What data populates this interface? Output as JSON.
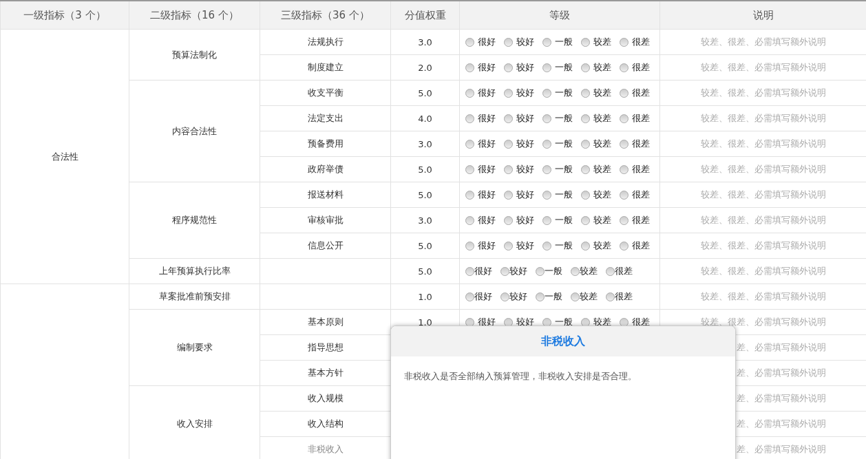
{
  "header": [
    "一级指标（3 个）",
    "二级指标（16 个）",
    "三级指标（36 个）",
    "分值权重",
    "等级",
    "说明"
  ],
  "groups": [
    {
      "label": "合法性",
      "sections": [
        {
          "label": "预算法制化",
          "items": [
            {
              "kind": "full",
              "label": "法规执行",
              "weight": "3.0",
              "grades": [
                {
                  "label": "很好",
                  "selected": false
                },
                {
                  "label": "较好",
                  "selected": false
                },
                {
                  "label": "一般",
                  "selected": false
                },
                {
                  "label": "较差",
                  "selected": false
                },
                {
                  "label": "很差",
                  "selected": false
                }
              ],
              "note": "较差、很差、必需填写额外说明"
            },
            {
              "kind": "full",
              "label": "制度建立",
              "weight": "2.0",
              "grades": [
                {
                  "label": "很好",
                  "selected": false
                },
                {
                  "label": "较好",
                  "selected": false
                },
                {
                  "label": "一般",
                  "selected": false
                },
                {
                  "label": "较差",
                  "selected": false
                },
                {
                  "label": "很差",
                  "selected": false
                }
              ],
              "note": "较差、很差、必需填写额外说明"
            }
          ]
        },
        {
          "label": "内容合法性",
          "items": [
            {
              "kind": "full",
              "label": "收支平衡",
              "weight": "5.0",
              "grades": [
                {
                  "label": "很好",
                  "selected": false
                },
                {
                  "label": "较好",
                  "selected": false
                },
                {
                  "label": "一般",
                  "selected": false
                },
                {
                  "label": "较差",
                  "selected": false
                },
                {
                  "label": "很差",
                  "selected": false
                }
              ],
              "note": "较差、很差、必需填写额外说明"
            },
            {
              "kind": "full",
              "label": "法定支出",
              "weight": "4.0",
              "grades": [
                {
                  "label": "很好",
                  "selected": false
                },
                {
                  "label": "较好",
                  "selected": false
                },
                {
                  "label": "一般",
                  "selected": false
                },
                {
                  "label": "较差",
                  "selected": false
                },
                {
                  "label": "很差",
                  "selected": false
                }
              ],
              "note": "较差、很差、必需填写额外说明"
            },
            {
              "kind": "full",
              "label": "预备费用",
              "weight": "3.0",
              "grades": [
                {
                  "label": "很好",
                  "selected": false
                },
                {
                  "label": "较好",
                  "selected": false
                },
                {
                  "label": "一般",
                  "selected": false
                },
                {
                  "label": "较差",
                  "selected": false
                },
                {
                  "label": "很差",
                  "selected": false
                }
              ],
              "note": "较差、很差、必需填写额外说明"
            },
            {
              "kind": "full",
              "label": "政府举债",
              "weight": "5.0",
              "grades": [
                {
                  "label": "很好",
                  "selected": false
                },
                {
                  "label": "较好",
                  "selected": false
                },
                {
                  "label": "一般",
                  "selected": false
                },
                {
                  "label": "较差",
                  "selected": false
                },
                {
                  "label": "很差",
                  "selected": false
                }
              ],
              "note": "较差、很差、必需填写额外说明"
            }
          ]
        },
        {
          "label": "程序规范性",
          "items": [
            {
              "kind": "full",
              "label": "报送材料",
              "weight": "5.0",
              "grades": [
                {
                  "label": "很好",
                  "selected": false
                },
                {
                  "label": "较好",
                  "selected": false
                },
                {
                  "label": "一般",
                  "selected": false
                },
                {
                  "label": "较差",
                  "selected": false
                },
                {
                  "label": "很差",
                  "selected": false
                }
              ],
              "note": "较差、很差、必需填写额外说明"
            },
            {
              "kind": "full",
              "label": "审核审批",
              "weight": "3.0",
              "grades": [
                {
                  "label": "很好",
                  "selected": false
                },
                {
                  "label": "较好",
                  "selected": false
                },
                {
                  "label": "一般",
                  "selected": false
                },
                {
                  "label": "较差",
                  "selected": false
                },
                {
                  "label": "很差",
                  "selected": false
                }
              ],
              "note": "较差、很差、必需填写额外说明"
            },
            {
              "kind": "full",
              "label": "信息公开",
              "weight": "5.0",
              "grades": [
                {
                  "label": "很好",
                  "selected": false
                },
                {
                  "label": "较好",
                  "selected": false
                },
                {
                  "label": "一般",
                  "selected": false
                },
                {
                  "label": "较差",
                  "selected": false
                },
                {
                  "label": "很差",
                  "selected": false
                }
              ],
              "note": "较差、很差、必需填写额外说明"
            }
          ]
        },
        {
          "label": "上年预算执行比率",
          "items": [
            {
              "kind": "compact",
              "weight": "5.0",
              "grades": [
                {
                  "label": "很好",
                  "selected": false
                },
                {
                  "label": "较好",
                  "selected": false
                },
                {
                  "label": "一般",
                  "selected": false
                },
                {
                  "label": "较差",
                  "selected": false
                },
                {
                  "label": "很差",
                  "selected": false
                }
              ],
              "note": "较差、很差、必需填写额外说明"
            }
          ]
        }
      ]
    },
    {
      "sections": [
        {
          "label": "草案批准前预安排",
          "items": [
            {
              "kind": "compact",
              "weight": "1.0",
              "grades": [
                {
                  "label": "很好",
                  "selected": false
                },
                {
                  "label": "较好",
                  "selected": false
                },
                {
                  "label": "一般",
                  "selected": false
                },
                {
                  "label": "较差",
                  "selected": false
                },
                {
                  "label": "很差",
                  "selected": false
                }
              ],
              "note": "较差、很差、必需填写额外说明"
            }
          ]
        },
        {
          "label": "编制要求",
          "items": [
            {
              "kind": "full",
              "label": "基本原则",
              "weight": "1.0",
              "grades": [
                {
                  "label": "很好",
                  "selected": false
                },
                {
                  "label": "较好",
                  "selected": false
                },
                {
                  "label": "一般",
                  "selected": false
                },
                {
                  "label": "较差",
                  "selected": false
                },
                {
                  "label": "很差",
                  "selected": false
                }
              ],
              "note": "较差、很差、必需填写额外说明"
            },
            {
              "kind": "covered",
              "label": "指导思想",
              "note": "差、必需填写额外说明"
            },
            {
              "kind": "covered",
              "label": "基本方针",
              "note": "差、必需填写额外说明"
            }
          ]
        },
        {
          "label": "收入安排",
          "items": [
            {
              "kind": "covered",
              "label": "收入规模",
              "note": "差、必需填写额外说明"
            },
            {
              "kind": "covered",
              "label": "收入结构",
              "note": "差、必需填写额外说明"
            },
            {
              "kind": "covered",
              "label": "非税收入",
              "dimmed": true,
              "note": "差、必需填写额外说明"
            }
          ]
        }
      ]
    }
  ],
  "popup": {
    "title": "非税收入",
    "body": "非税收入是否全部纳入预算管理，非税收入安排是否合理。"
  }
}
